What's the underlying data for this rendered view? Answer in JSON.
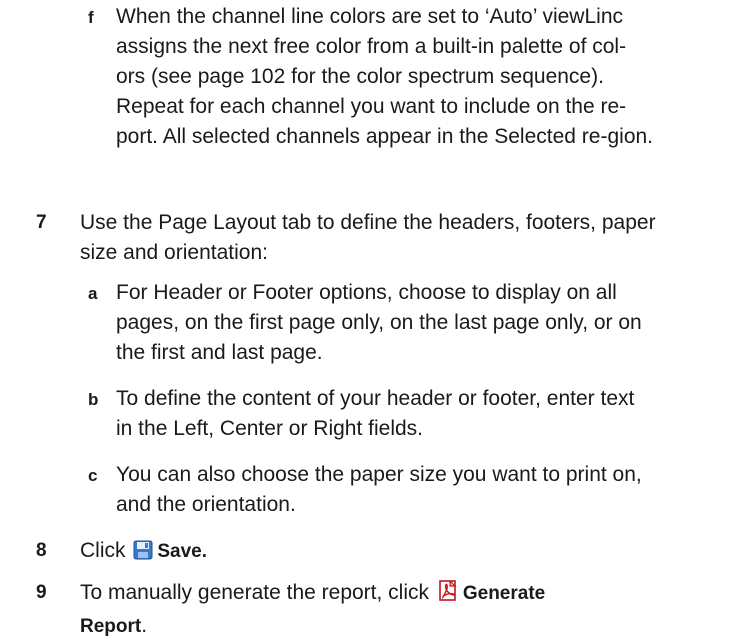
{
  "sub_f": {
    "letter": "f",
    "text": "When the channel line colors are set to ‘Auto’ viewLinc assigns the next free color from a built-in palette of col-ors (see page 102 for the color spectrum sequence). Repeat for each channel you want to include on the re-port. All selected channels appear in the Selected re-gion."
  },
  "step7": {
    "num": "7",
    "text": "Use the Page Layout tab to define the headers, footers, paper size and orientation:",
    "subs": [
      {
        "letter": "a",
        "text": "For Header or Footer options, choose to display on all pages, on the first page only, on the last page only, or on the first and last page."
      },
      {
        "letter": "b",
        "text": "To define the content of your header or footer, enter text in the Left, Center or Right fields."
      },
      {
        "letter": "c",
        "text": "You can also choose the paper size you want to print on, and the orientation."
      }
    ]
  },
  "step8": {
    "num": "8",
    "prefix": "Click",
    "icon": "save-icon",
    "label": "Save."
  },
  "step9": {
    "num": "9",
    "prefix": "To manually generate the report, click",
    "icon": "pdf-icon",
    "label_1": "Generate",
    "label_2": "Report",
    "suffix": "."
  }
}
